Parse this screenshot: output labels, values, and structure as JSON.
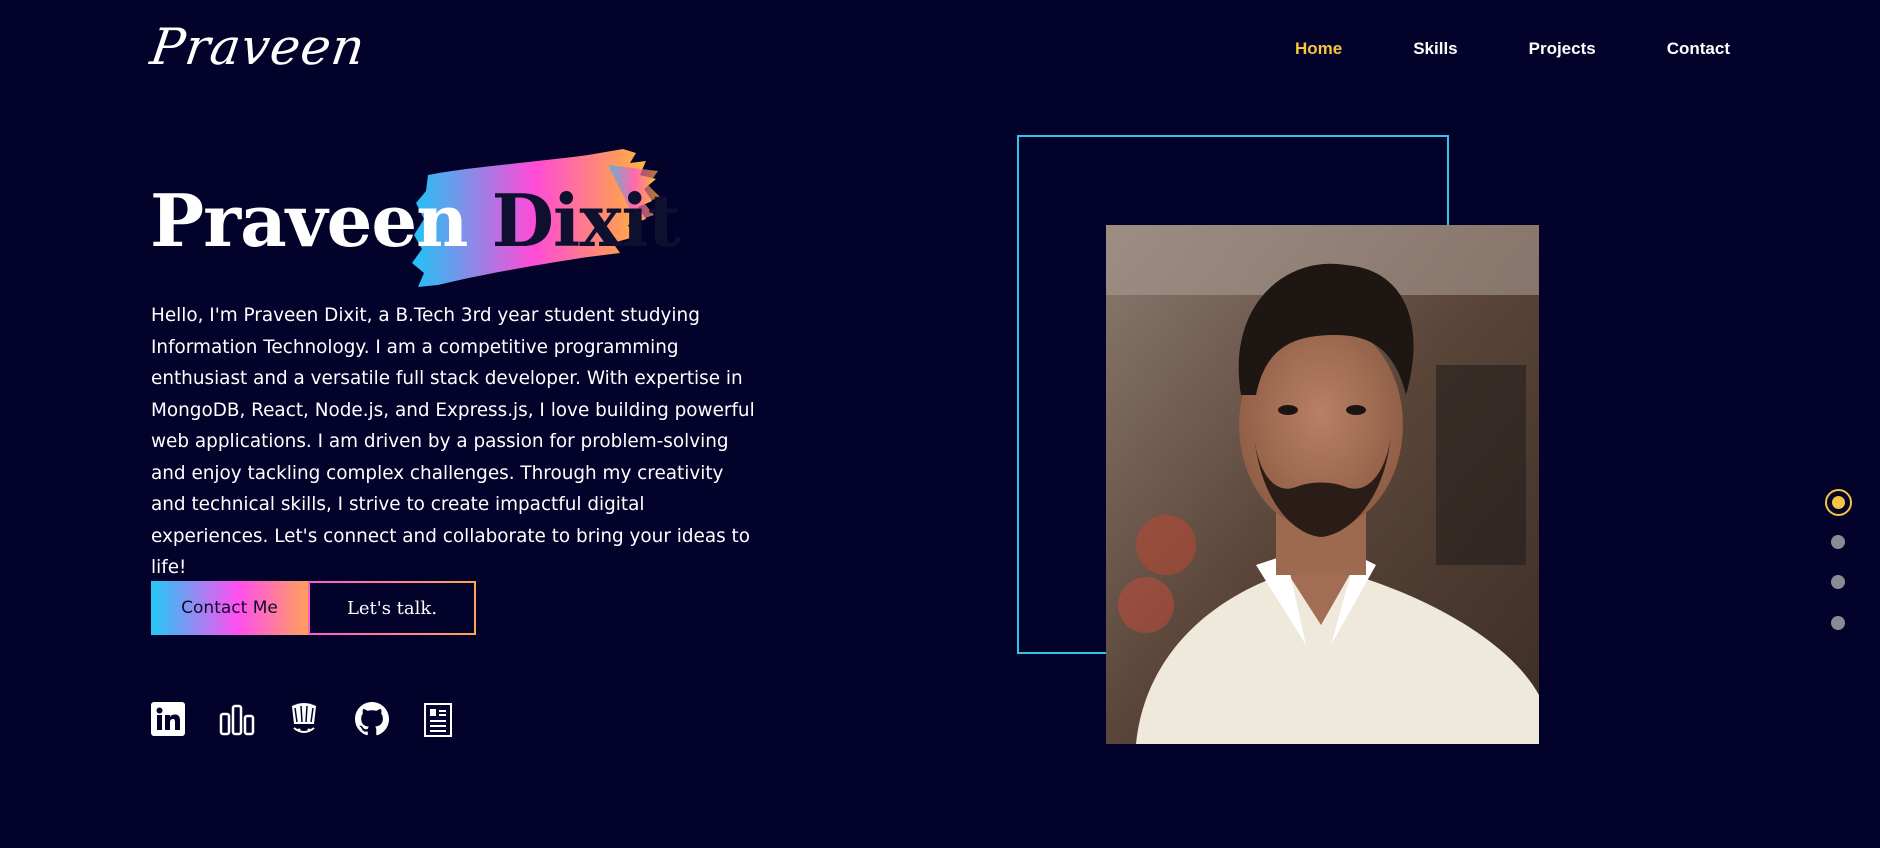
{
  "header": {
    "logo": "Praveen",
    "nav": [
      {
        "label": "Home",
        "active": true
      },
      {
        "label": "Skills",
        "active": false
      },
      {
        "label": "Projects",
        "active": false
      },
      {
        "label": "Contact",
        "active": false
      }
    ]
  },
  "hero": {
    "first_name": "Praveen",
    "last_name": "Dixit",
    "intro": "Hello, I'm Praveen Dixit, a B.Tech 3rd year student studying Information Technology. I am a competitive programming enthusiast and a versatile full stack developer. With expertise in MongoDB, React, Node.js, and Express.js, I love building powerful web applications. I am driven by a passion for problem-solving and enjoy tackling complex challenges. Through my creativity and technical skills, I strive to create impactful digital experiences. Let's connect and collaborate to bring your ideas to life!",
    "contact_button": "Contact Me",
    "talk_button": "Let's talk."
  },
  "socials": [
    {
      "icon": "linkedin-icon"
    },
    {
      "icon": "codeforces-icon"
    },
    {
      "icon": "codechef-icon"
    },
    {
      "icon": "github-icon"
    },
    {
      "icon": "resume-icon"
    }
  ],
  "section_dots": {
    "count": 4,
    "active_index": 0
  },
  "colors": {
    "background": "#02022a",
    "accent": "#f5c542",
    "frame": "#2ec5e6",
    "gradient": [
      "#22c9f6",
      "#ff4ff0",
      "#ffa15a"
    ]
  }
}
